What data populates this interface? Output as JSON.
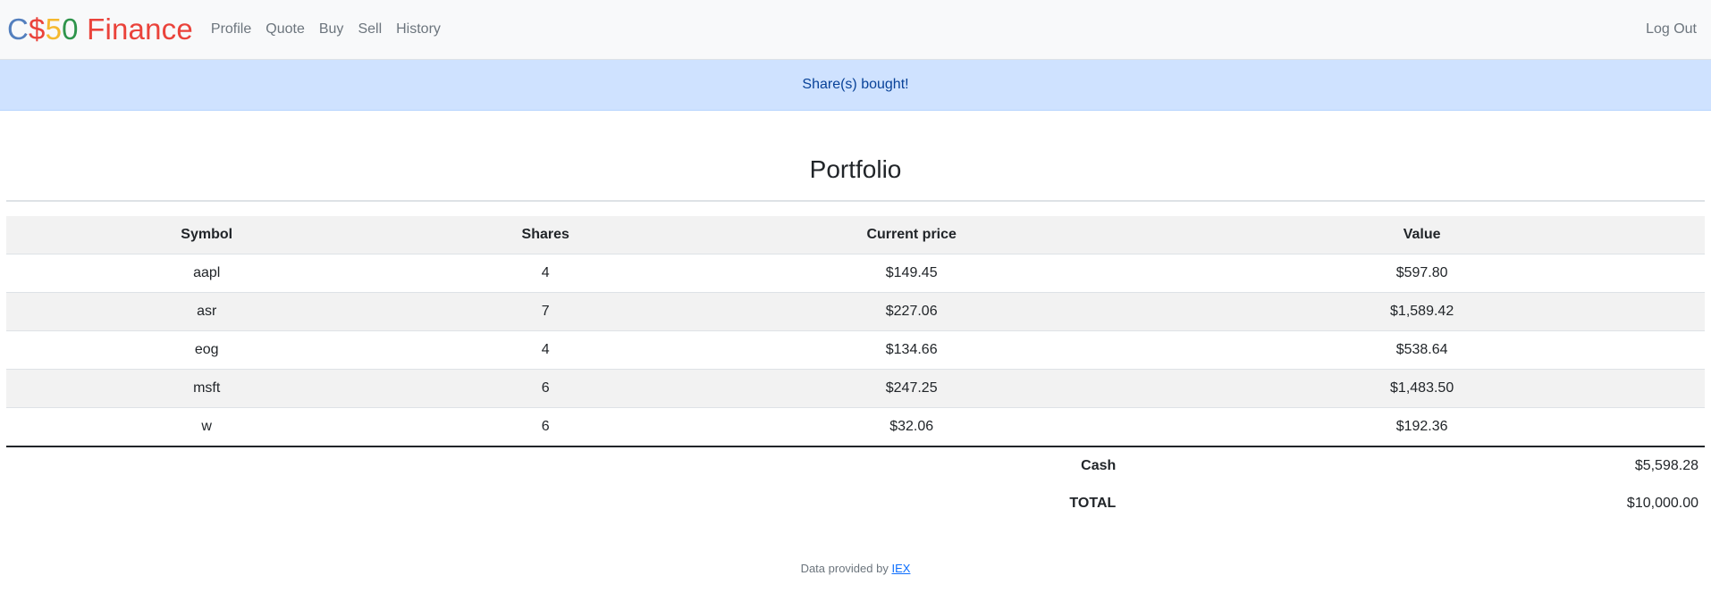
{
  "brand": {
    "c": "C",
    "dollar": "$",
    "five": "5",
    "zero": "0",
    "finance": " Finance"
  },
  "nav": {
    "items": [
      {
        "label": "Profile"
      },
      {
        "label": "Quote"
      },
      {
        "label": "Buy"
      },
      {
        "label": "Sell"
      },
      {
        "label": "History"
      }
    ],
    "logout": "Log Out"
  },
  "alert": {
    "message": "Share(s) bought!"
  },
  "page_title": "Portfolio",
  "table": {
    "headers": [
      "Symbol",
      "Shares",
      "Current price",
      "Value"
    ],
    "rows": [
      [
        "aapl",
        "4",
        "$149.45",
        "$597.80"
      ],
      [
        "asr",
        "7",
        "$227.06",
        "$1,589.42"
      ],
      [
        "eog",
        "4",
        "$134.66",
        "$538.64"
      ],
      [
        "msft",
        "6",
        "$247.25",
        "$1,483.50"
      ],
      [
        "w",
        "6",
        "$32.06",
        "$192.36"
      ]
    ],
    "cash_label": "Cash",
    "cash_value": "$5,598.28",
    "total_label": "TOTAL",
    "total_value": "$10,000.00"
  },
  "footer": {
    "text": "Data provided by ",
    "link": "IEX"
  },
  "colors": {
    "brand_blue": "#537fbe",
    "brand_red": "#ea433b",
    "brand_yellow": "#f5b82e",
    "brand_green": "#2e944b",
    "alert_bg": "#cfe2ff",
    "alert_text": "#084298",
    "navbar_bg": "#f8f9fa"
  }
}
